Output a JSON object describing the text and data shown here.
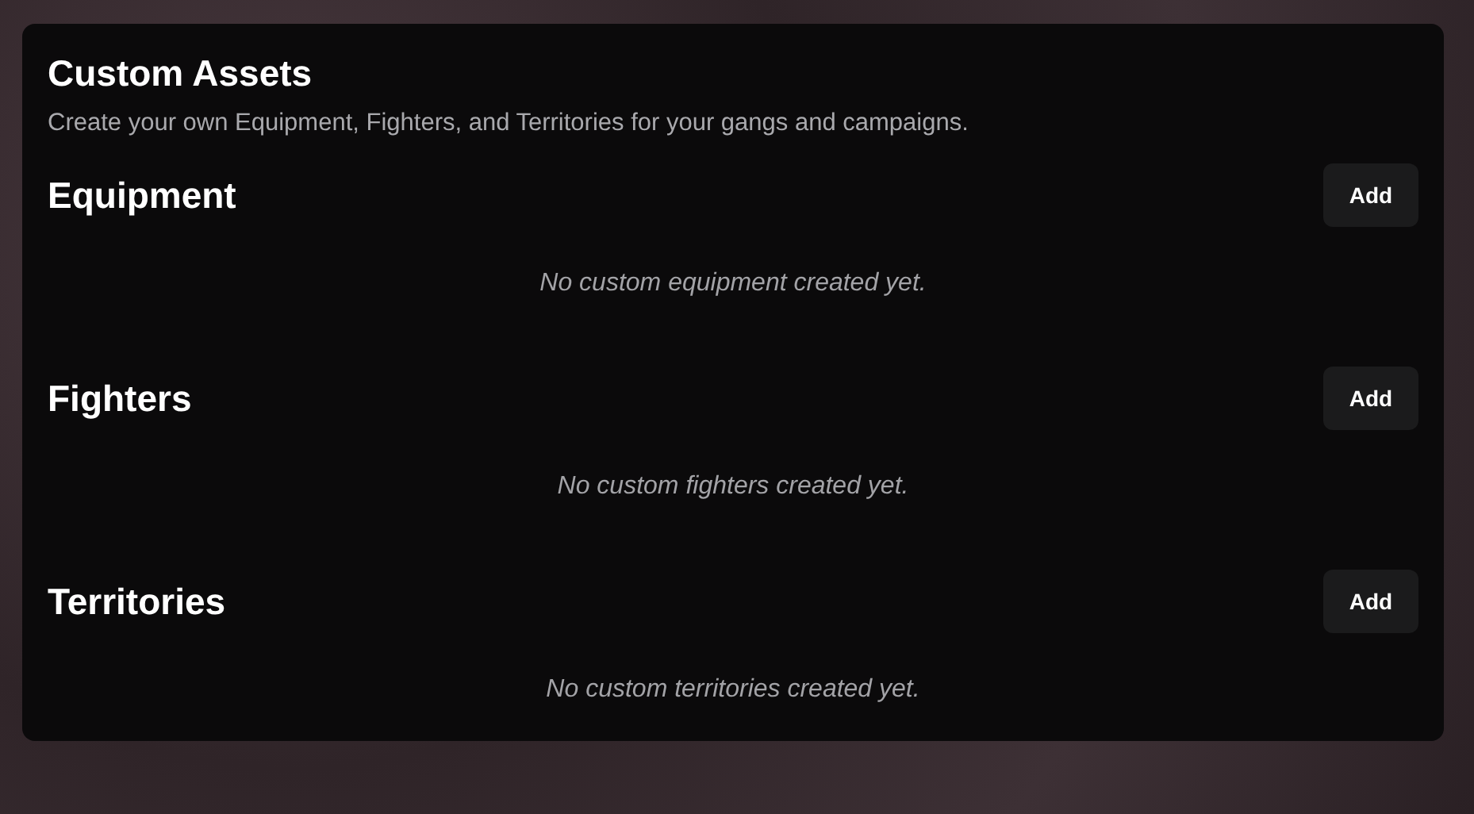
{
  "panel": {
    "title": "Custom Assets",
    "description": "Create your own Equipment, Fighters, and Territories for your gangs and campaigns."
  },
  "sections": [
    {
      "title": "Equipment",
      "button": "Add",
      "empty_message": "No custom equipment created yet."
    },
    {
      "title": "Fighters",
      "button": "Add",
      "empty_message": "No custom fighters created yet."
    },
    {
      "title": "Territories",
      "button": "Add",
      "empty_message": "No custom territories created yet."
    }
  ]
}
